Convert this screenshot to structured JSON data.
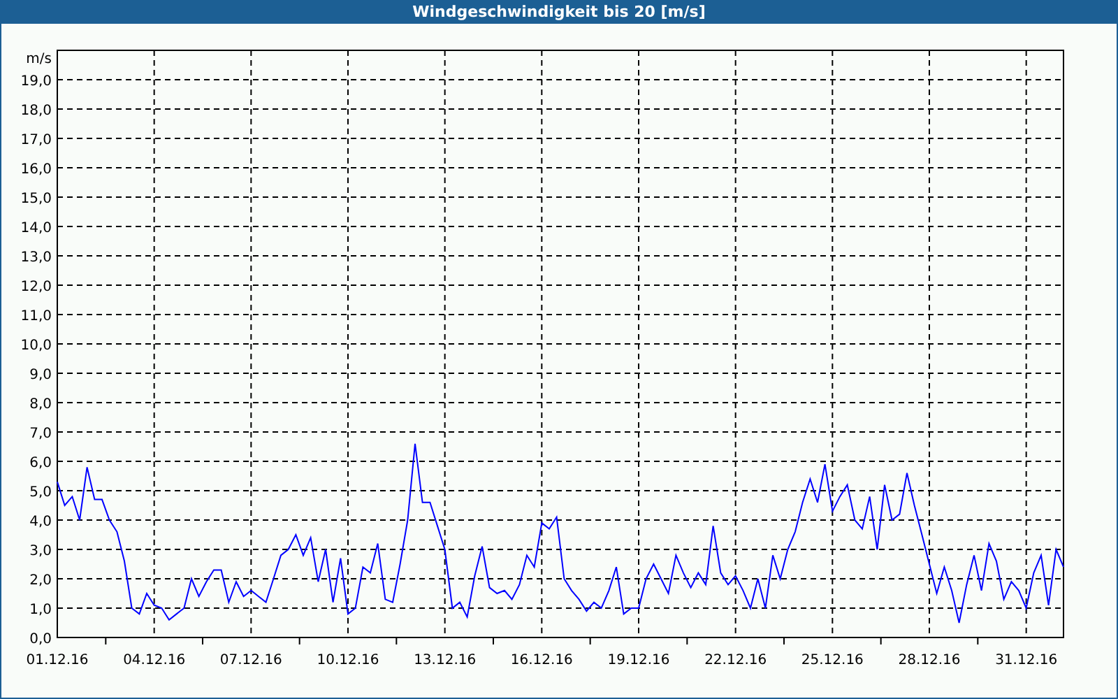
{
  "window": {
    "title": "Windgeschwindigkeit bis 20 [m/s]"
  },
  "chart_data": {
    "type": "line",
    "ylabel": "m/s",
    "ylim": [
      0,
      20
    ],
    "grid": true,
    "categories": [
      "01.12.16",
      null,
      null,
      null,
      null,
      null,
      null,
      null,
      null,
      null,
      null,
      null,
      null,
      "04.12.16",
      null,
      null,
      null,
      null,
      null,
      null,
      null,
      null,
      null,
      null,
      null,
      null,
      "07.12.16",
      null,
      null,
      null,
      null,
      null,
      null,
      null,
      null,
      null,
      null,
      null,
      null,
      "10.12.16",
      null,
      null,
      null,
      null,
      null,
      null,
      null,
      null,
      null,
      null,
      null,
      null,
      "13.12.16",
      null,
      null,
      null,
      null,
      null,
      null,
      null,
      null,
      null,
      null,
      null,
      null,
      "16.12.16",
      null,
      null,
      null,
      null,
      null,
      null,
      null,
      null,
      null,
      null,
      null,
      null,
      "19.12.16",
      null,
      null,
      null,
      null,
      null,
      null,
      null,
      null,
      null,
      null,
      null,
      null,
      "22.12.16",
      null,
      null,
      null,
      null,
      null,
      null,
      null,
      null,
      null,
      null,
      null,
      null,
      "25.12.16",
      null,
      null,
      null,
      null,
      null,
      null,
      null,
      null,
      null,
      null,
      null,
      null,
      "28.12.16",
      null,
      null,
      null,
      null,
      null,
      null,
      null,
      null,
      null,
      null,
      null,
      null,
      "31.12.16",
      null,
      null,
      null,
      null,
      null
    ],
    "series": [
      {
        "color": "#0000ff",
        "values": [
          5.3,
          4.5,
          4.8,
          4.0,
          5.8,
          4.7,
          4.7,
          4.0,
          3.6,
          2.6,
          1.0,
          0.8,
          1.5,
          1.1,
          1.0,
          0.6,
          0.8,
          1.0,
          2.0,
          1.4,
          1.9,
          2.3,
          2.3,
          1.2,
          1.9,
          1.4,
          1.6,
          1.4,
          1.2,
          2.0,
          2.8,
          3.0,
          3.5,
          2.8,
          3.4,
          1.9,
          3.0,
          1.2,
          2.7,
          0.8,
          1.0,
          2.4,
          2.2,
          3.2,
          1.3,
          1.2,
          2.5,
          4.0,
          6.6,
          4.6,
          4.6,
          3.8,
          3.0,
          1.0,
          1.2,
          0.7,
          2.1,
          3.1,
          1.7,
          1.5,
          1.6,
          1.3,
          1.8,
          2.8,
          2.4,
          3.9,
          3.7,
          4.1,
          2.0,
          1.6,
          1.3,
          0.9,
          1.2,
          1.0,
          1.6,
          2.4,
          0.8,
          1.0,
          1.0,
          2.0,
          2.5,
          2.0,
          1.5,
          2.8,
          2.2,
          1.7,
          2.2,
          1.8,
          3.8,
          2.2,
          1.8,
          2.1,
          1.6,
          1.0,
          2.0,
          1.0,
          2.8,
          2.0,
          3.0,
          3.6,
          4.6,
          5.4,
          4.6,
          5.9,
          4.3,
          4.8,
          5.2,
          4.0,
          3.7,
          4.8,
          3.0,
          5.2,
          4.0,
          4.2,
          5.6,
          4.5,
          3.5,
          2.5,
          1.5,
          2.4,
          1.6,
          0.5,
          1.8,
          2.8,
          1.6,
          3.2,
          2.6,
          1.3,
          1.9,
          1.6,
          1.0,
          2.2,
          2.8,
          1.1,
          3.0,
          2.4
        ]
      }
    ],
    "yticks": [
      {
        "value": 0,
        "label": "0,0"
      },
      {
        "value": 1,
        "label": "1,0"
      },
      {
        "value": 2,
        "label": "2,0"
      },
      {
        "value": 3,
        "label": "3,0"
      },
      {
        "value": 4,
        "label": "4,0"
      },
      {
        "value": 5,
        "label": "5,0"
      },
      {
        "value": 6,
        "label": "6,0"
      },
      {
        "value": 7,
        "label": "7,0"
      },
      {
        "value": 8,
        "label": "8,0"
      },
      {
        "value": 9,
        "label": "9,0"
      },
      {
        "value": 10,
        "label": "10,0"
      },
      {
        "value": 11,
        "label": "11,0"
      },
      {
        "value": 12,
        "label": "12,0"
      },
      {
        "value": 13,
        "label": "13,0"
      },
      {
        "value": 14,
        "label": "14,0"
      },
      {
        "value": 15,
        "label": "15,0"
      },
      {
        "value": 16,
        "label": "16,0"
      },
      {
        "value": 17,
        "label": "17,0"
      },
      {
        "value": 18,
        "label": "18,0"
      },
      {
        "value": 19,
        "label": "19,0"
      }
    ]
  }
}
